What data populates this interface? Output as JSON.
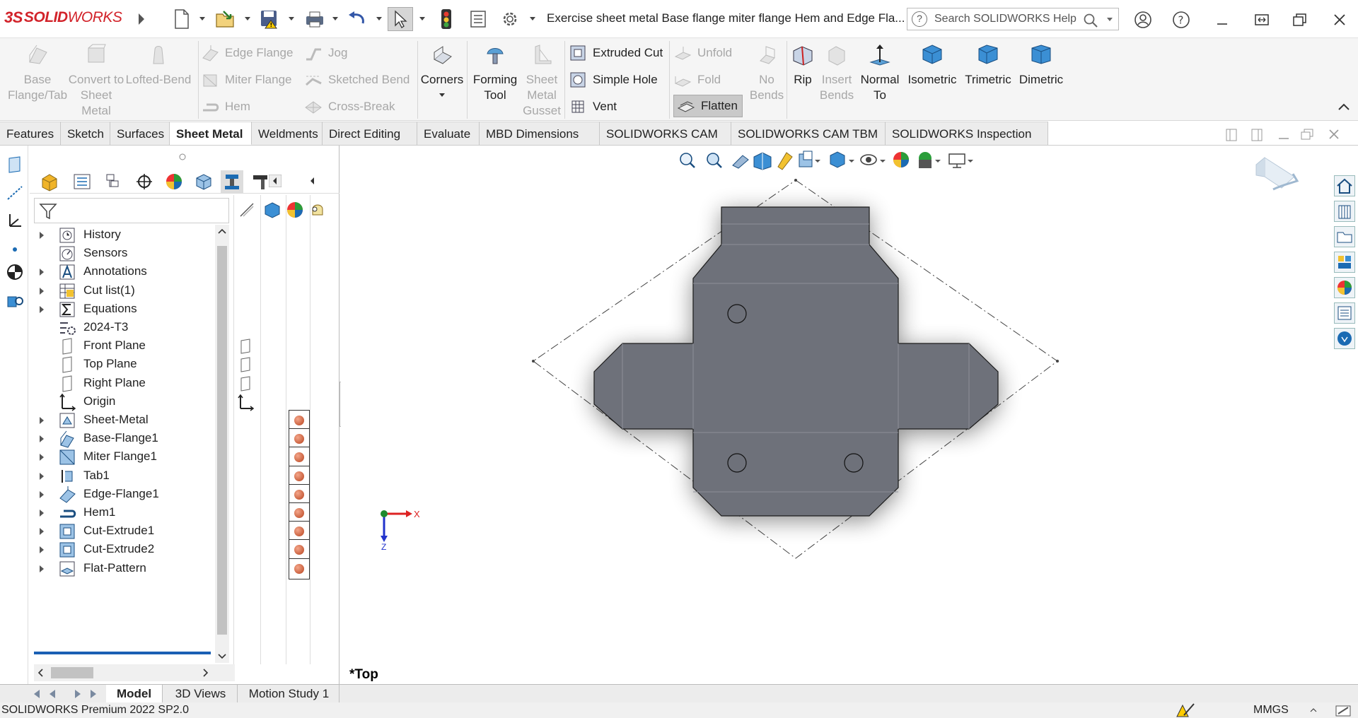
{
  "app": {
    "brand_prefix": "3S",
    "brand_bold": "SOLID",
    "brand_rest": "WORKS"
  },
  "title": "Exercise sheet metal Base flange miter flange Hem and Edge Fla...",
  "search": {
    "placeholder": "Search SOLIDWORKS Help"
  },
  "toolbar": {
    "base_flange": "Base Flange/Tab",
    "convert": "Convert to Sheet Metal",
    "lofted_bend": "Lofted-Bend",
    "edge_flange": "Edge Flange",
    "miter_flange": "Miter Flange",
    "hem": "Hem",
    "jog": "Jog",
    "sketched_bend": "Sketched Bend",
    "cross_break": "Cross-Break",
    "corners": "Corners",
    "forming_tool": "Forming Tool",
    "sheet_metal_gusset": "Sheet Metal Gusset",
    "extruded_cut": "Extruded Cut",
    "simple_hole": "Simple Hole",
    "vent": "Vent",
    "unfold": "Unfold",
    "fold": "Fold",
    "flatten": "Flatten",
    "no_bends": "No Bends",
    "rip": "Rip",
    "insert_bends": "Insert Bends",
    "normal_to": "Normal To",
    "isometric": "Isometric",
    "trimetric": "Trimetric",
    "dimetric": "Dimetric"
  },
  "tabs": [
    "Features",
    "Sketch",
    "Surfaces",
    "Sheet Metal",
    "Weldments",
    "Direct Editing",
    "Evaluate",
    "MBD Dimensions",
    "SOLIDWORKS CAM",
    "SOLIDWORKS CAM TBM",
    "SOLIDWORKS Inspection"
  ],
  "active_tab": "Sheet Metal",
  "tree": [
    {
      "label": "History",
      "expandable": true,
      "icon": "history-icon"
    },
    {
      "label": "Sensors",
      "expandable": false,
      "icon": "sensors-icon"
    },
    {
      "label": "Annotations",
      "expandable": true,
      "icon": "annotations-icon"
    },
    {
      "label": "Cut list(1)",
      "expandable": true,
      "icon": "cut-list-icon"
    },
    {
      "label": "Equations",
      "expandable": true,
      "icon": "equations-icon"
    },
    {
      "label": "2024-T3",
      "expandable": false,
      "icon": "material-icon"
    },
    {
      "label": "Front Plane",
      "expandable": false,
      "icon": "plane-icon"
    },
    {
      "label": "Top Plane",
      "expandable": false,
      "icon": "plane-icon"
    },
    {
      "label": "Right Plane",
      "expandable": false,
      "icon": "plane-icon"
    },
    {
      "label": "Origin",
      "expandable": false,
      "icon": "origin-icon"
    },
    {
      "label": "Sheet-Metal",
      "expandable": true,
      "icon": "sheet-metal-icon"
    },
    {
      "label": "Base-Flange1",
      "expandable": true,
      "icon": "base-flange-icon"
    },
    {
      "label": "Miter Flange1",
      "expandable": true,
      "icon": "miter-flange-icon"
    },
    {
      "label": "Tab1",
      "expandable": true,
      "icon": "tab-icon"
    },
    {
      "label": "Edge-Flange1",
      "expandable": true,
      "icon": "edge-flange-icon"
    },
    {
      "label": "Hem1",
      "expandable": true,
      "icon": "hem-icon"
    },
    {
      "label": "Cut-Extrude1",
      "expandable": true,
      "icon": "cut-extrude-icon"
    },
    {
      "label": "Cut-Extrude2",
      "expandable": true,
      "icon": "cut-extrude-icon"
    },
    {
      "label": "Flat-Pattern",
      "expandable": true,
      "icon": "flat-pattern-icon"
    }
  ],
  "view_label": "*Top",
  "triad": {
    "x": "X",
    "z": "Z"
  },
  "bottom_tabs": [
    "Model",
    "3D Views",
    "Motion Study 1"
  ],
  "active_bottom_tab": "Model",
  "status": {
    "product": "SOLIDWORKS Premium 2022 SP2.0",
    "units": "MMGS"
  },
  "colors": {
    "brand": "#d2232a",
    "part": "#6e717a",
    "accent": "#1a5fb4"
  }
}
